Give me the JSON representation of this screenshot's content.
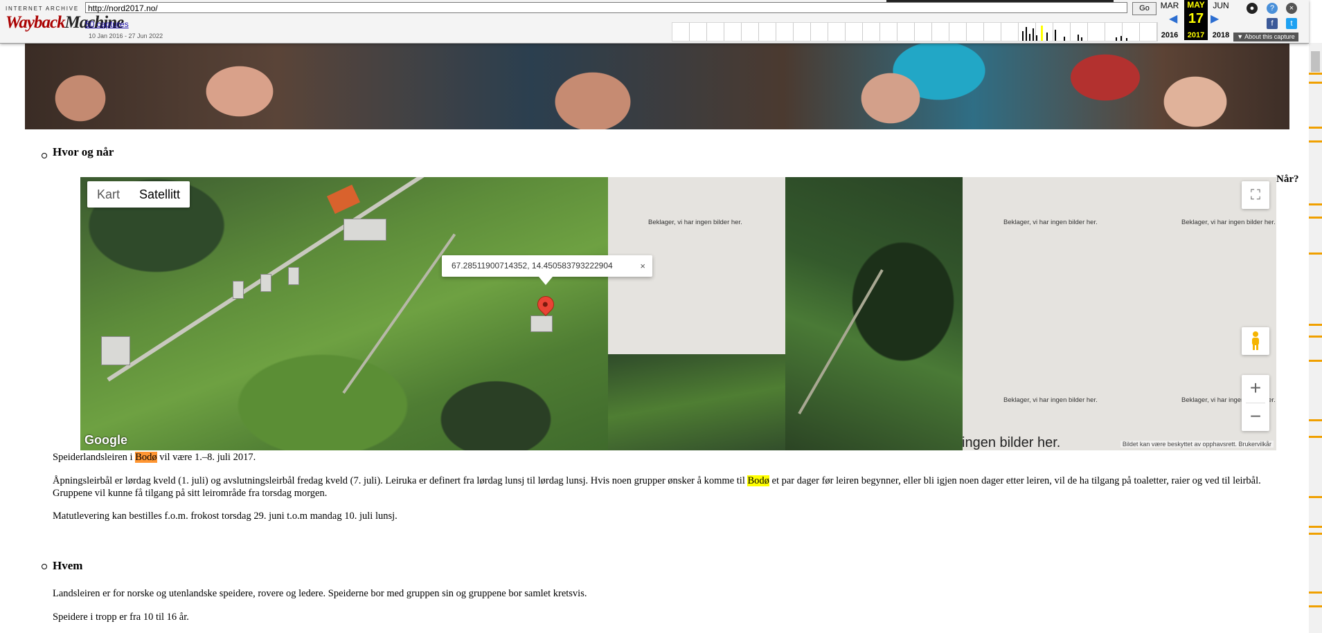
{
  "wayback": {
    "ia_label": "INTERNET ARCHIVE",
    "logo_red": "Wayback",
    "logo_dark": "Machine",
    "url": "http://nord2017.no/",
    "go_label": "Go",
    "captures": "50 captures",
    "date_range": "10 Jan 2016 - 27 Jun 2022",
    "prev_month": "MAR",
    "cur_month": "MAY",
    "next_month": "JUN",
    "cur_day": "17",
    "prev_year": "2016",
    "cur_year": "2017",
    "next_year": "2018",
    "about": "▼ About this capture",
    "prev_arrow": "◀",
    "next_arrow": "▶"
  },
  "section1": {
    "title": "Hvor og når",
    "side_heading": "Når?"
  },
  "map": {
    "type_kart": "Kart",
    "type_satellitt": "Satellitt",
    "infowindow": "67.28511900714352, 14.450583793222904",
    "close": "×",
    "no_images": "Beklager, vi har ingen bilder her.",
    "no_images_big": "ingen bilder her.",
    "logo": "Google",
    "attribution": "Bildet kan være beskyttet av opphavsrett.  Brukervilkår",
    "zoom_in": "+",
    "zoom_out": "−",
    "fullscreen": "⛶"
  },
  "para1": {
    "pre": "Speiderlandsleiren i ",
    "hl": "Bodø",
    "post": " vil være 1.–8. juli 2017."
  },
  "para2": {
    "pre": "Åpningsleirbål er lørdag kveld (1. juli) og avslutningsleirbål fredag kveld (7. juli). Leiruka er definert fra lørdag lunsj til lørdag lunsj. Hvis noen grupper ønsker å komme til ",
    "hl": "Bodø",
    "post": " et par dager før leiren begynner, eller bli igjen noen dager etter leiren, vil de ha tilgang på toaletter, raier og ved til leirbål. Gruppene vil kunne få tilgang på sitt leirområde fra torsdag morgen."
  },
  "para3": "Matutlevering kan bestilles f.o.m. frokost torsdag 29. juni t.o.m mandag 10. juli lunsj.",
  "section2": {
    "title": "Hvem"
  },
  "para4": "Landsleiren er for norske og utenlandske speidere, rovere og ledere. Speiderne bor med gruppen sin og gruppene bor samlet kretsvis.",
  "para5": "Speidere i tropp er fra 10 til 16 år."
}
